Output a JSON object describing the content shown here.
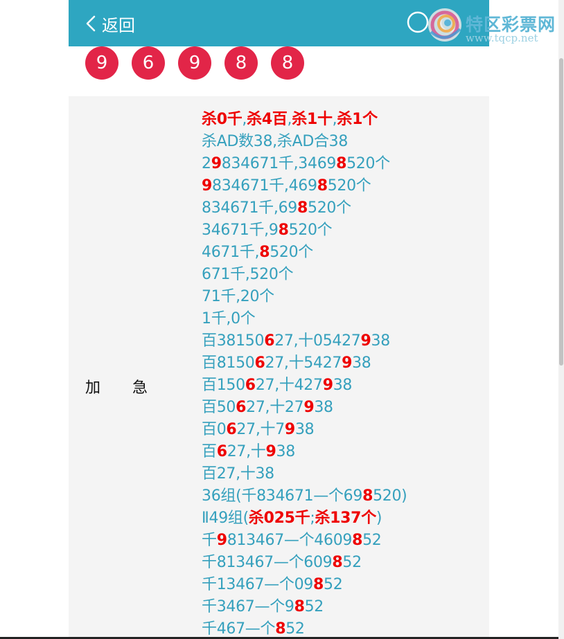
{
  "header": {
    "back_label": "返回"
  },
  "logo": {
    "name": "特区彩票网",
    "url": "www.tqcp.net"
  },
  "numbers": [
    "9",
    "6",
    "9",
    "8",
    "8"
  ],
  "colors": {
    "header": "#2ea6c1",
    "ball": "#e22548",
    "text": "#35a0bd",
    "highlight": "#ee0000"
  },
  "panel": {
    "label_a": "加",
    "label_b": "急",
    "lines": [
      [
        [
          "r",
          "杀0千"
        ],
        [
          "n",
          ","
        ],
        [
          "r",
          "杀4百"
        ],
        [
          "n",
          ","
        ],
        [
          "r",
          "杀1十"
        ],
        [
          "n",
          ","
        ],
        [
          "r",
          "杀1个"
        ]
      ],
      [
        [
          "n",
          "杀AD数38,杀AD合38"
        ]
      ],
      [
        [
          "n",
          "2"
        ],
        [
          "r",
          "9"
        ],
        [
          "n",
          "834671千,3469"
        ],
        [
          "r",
          "8"
        ],
        [
          "n",
          "520个"
        ]
      ],
      [
        [
          "r",
          "9"
        ],
        [
          "n",
          "834671千,469"
        ],
        [
          "r",
          "8"
        ],
        [
          "n",
          "520个"
        ]
      ],
      [
        [
          "n",
          "834671千,69"
        ],
        [
          "r",
          "8"
        ],
        [
          "n",
          "520个"
        ]
      ],
      [
        [
          "n",
          "34671千,9"
        ],
        [
          "r",
          "8"
        ],
        [
          "n",
          "520个"
        ]
      ],
      [
        [
          "n",
          "4671千,"
        ],
        [
          "r",
          "8"
        ],
        [
          "n",
          "520个"
        ]
      ],
      [
        [
          "n",
          "671千,520个"
        ]
      ],
      [
        [
          "n",
          "71千,20个"
        ]
      ],
      [
        [
          "n",
          "1千,0个"
        ]
      ],
      [
        [
          "n",
          "百38150"
        ],
        [
          "r",
          "6"
        ],
        [
          "n",
          "27,十05427"
        ],
        [
          "r",
          "9"
        ],
        [
          "n",
          "38"
        ]
      ],
      [
        [
          "n",
          "百8150"
        ],
        [
          "r",
          "6"
        ],
        [
          "n",
          "27,十5427"
        ],
        [
          "r",
          "9"
        ],
        [
          "n",
          "38"
        ]
      ],
      [
        [
          "n",
          "百150"
        ],
        [
          "r",
          "6"
        ],
        [
          "n",
          "27,十427"
        ],
        [
          "r",
          "9"
        ],
        [
          "n",
          "38"
        ]
      ],
      [
        [
          "n",
          "百50"
        ],
        [
          "r",
          "6"
        ],
        [
          "n",
          "27,十27"
        ],
        [
          "r",
          "9"
        ],
        [
          "n",
          "38"
        ]
      ],
      [
        [
          "n",
          "百0"
        ],
        [
          "r",
          "6"
        ],
        [
          "n",
          "27,十7"
        ],
        [
          "r",
          "9"
        ],
        [
          "n",
          "38"
        ]
      ],
      [
        [
          "n",
          "百"
        ],
        [
          "r",
          "6"
        ],
        [
          "n",
          "27,十"
        ],
        [
          "r",
          "9"
        ],
        [
          "n",
          "38"
        ]
      ],
      [
        [
          "n",
          "百27,十38"
        ]
      ],
      [
        [
          "n",
          "36组(千834671—个69"
        ],
        [
          "r",
          "8"
        ],
        [
          "n",
          "520)"
        ]
      ],
      [
        [
          "n",
          "Ⅱ49组("
        ],
        [
          "r",
          "杀025千"
        ],
        [
          "n",
          ";"
        ],
        [
          "r",
          "杀137个"
        ],
        [
          "n",
          ")"
        ]
      ],
      [
        [
          "n",
          "千"
        ],
        [
          "r",
          "9"
        ],
        [
          "n",
          "813467—个4609"
        ],
        [
          "r",
          "8"
        ],
        [
          "n",
          "52"
        ]
      ],
      [
        [
          "n",
          "千813467—个609"
        ],
        [
          "r",
          "8"
        ],
        [
          "n",
          "52"
        ]
      ],
      [
        [
          "n",
          "千13467—个09"
        ],
        [
          "r",
          "8"
        ],
        [
          "n",
          "52"
        ]
      ],
      [
        [
          "n",
          "千3467—个9"
        ],
        [
          "r",
          "8"
        ],
        [
          "n",
          "52"
        ]
      ],
      [
        [
          "n",
          "千467—个"
        ],
        [
          "r",
          "8"
        ],
        [
          "n",
          "52"
        ]
      ]
    ]
  }
}
